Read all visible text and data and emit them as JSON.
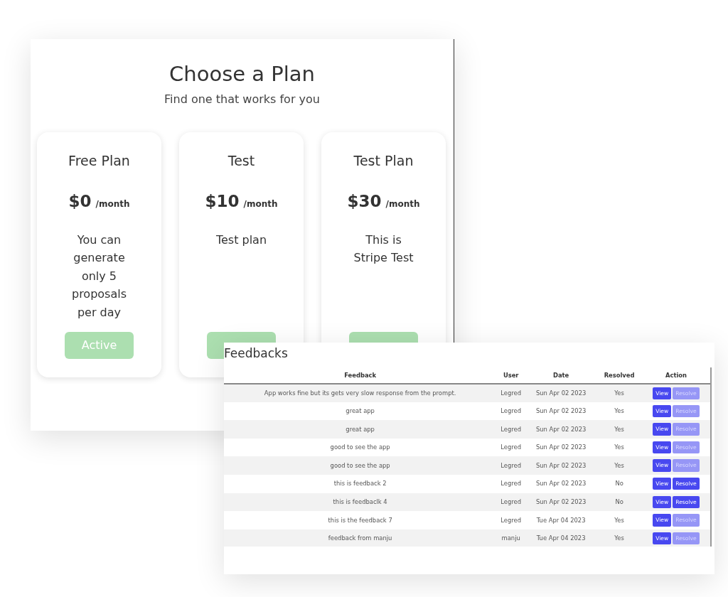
{
  "plans_panel": {
    "title": "Choose a Plan",
    "subtitle": "Find one that works for you",
    "plans": [
      {
        "name": "Free Plan",
        "price": "$0",
        "period": "/month",
        "description": "You can generate only 5 proposals per day",
        "button": "Active"
      },
      {
        "name": "Test",
        "price": "$10",
        "period": "/month",
        "description": "Test plan"
      },
      {
        "name": "Test Plan",
        "price": "$30",
        "period": "/month",
        "description": "This is Stripe Test"
      }
    ]
  },
  "feedback_panel": {
    "title": "Feedbacks",
    "table": {
      "columns": [
        "Feedback",
        "User",
        "Date",
        "Resolved",
        "Action"
      ],
      "rows": [
        {
          "feedback": "App works fine but its gets very slow response from the prompt.",
          "user": "Legred",
          "date": "Sun Apr 02 2023",
          "resolved": "Yes",
          "view": "View",
          "resolve": "Resolve",
          "resolve_disabled": true
        },
        {
          "feedback": "great app",
          "user": "Legred",
          "date": "Sun Apr 02 2023",
          "resolved": "Yes",
          "view": "View",
          "resolve": "Resolve",
          "resolve_disabled": true
        },
        {
          "feedback": "great app",
          "user": "Legred",
          "date": "Sun Apr 02 2023",
          "resolved": "Yes",
          "view": "View",
          "resolve": "Resolve",
          "resolve_disabled": true
        },
        {
          "feedback": "good to see the app",
          "user": "Legred",
          "date": "Sun Apr 02 2023",
          "resolved": "Yes",
          "view": "View",
          "resolve": "Resolve",
          "resolve_disabled": true
        },
        {
          "feedback": "good to see the app",
          "user": "Legred",
          "date": "Sun Apr 02 2023",
          "resolved": "Yes",
          "view": "View",
          "resolve": "Resolve",
          "resolve_disabled": true
        },
        {
          "feedback": "this is feedback 2",
          "user": "Legred",
          "date": "Sun Apr 02 2023",
          "resolved": "No",
          "view": "View",
          "resolve": "Resolve",
          "resolve_disabled": false
        },
        {
          "feedback": "this is feedbaclk 4",
          "user": "Legred",
          "date": "Sun Apr 02 2023",
          "resolved": "No",
          "view": "View",
          "resolve": "Resolve",
          "resolve_disabled": false
        },
        {
          "feedback": "this is the feedback 7",
          "user": "Legred",
          "date": "Tue Apr 04 2023",
          "resolved": "Yes",
          "view": "View",
          "resolve": "Resolve",
          "resolve_disabled": true
        },
        {
          "feedback": "feedback from manju",
          "user": "manju",
          "date": "Tue Apr 04 2023",
          "resolved": "Yes",
          "view": "View",
          "resolve": "Resolve",
          "resolve_disabled": true
        }
      ]
    }
  }
}
